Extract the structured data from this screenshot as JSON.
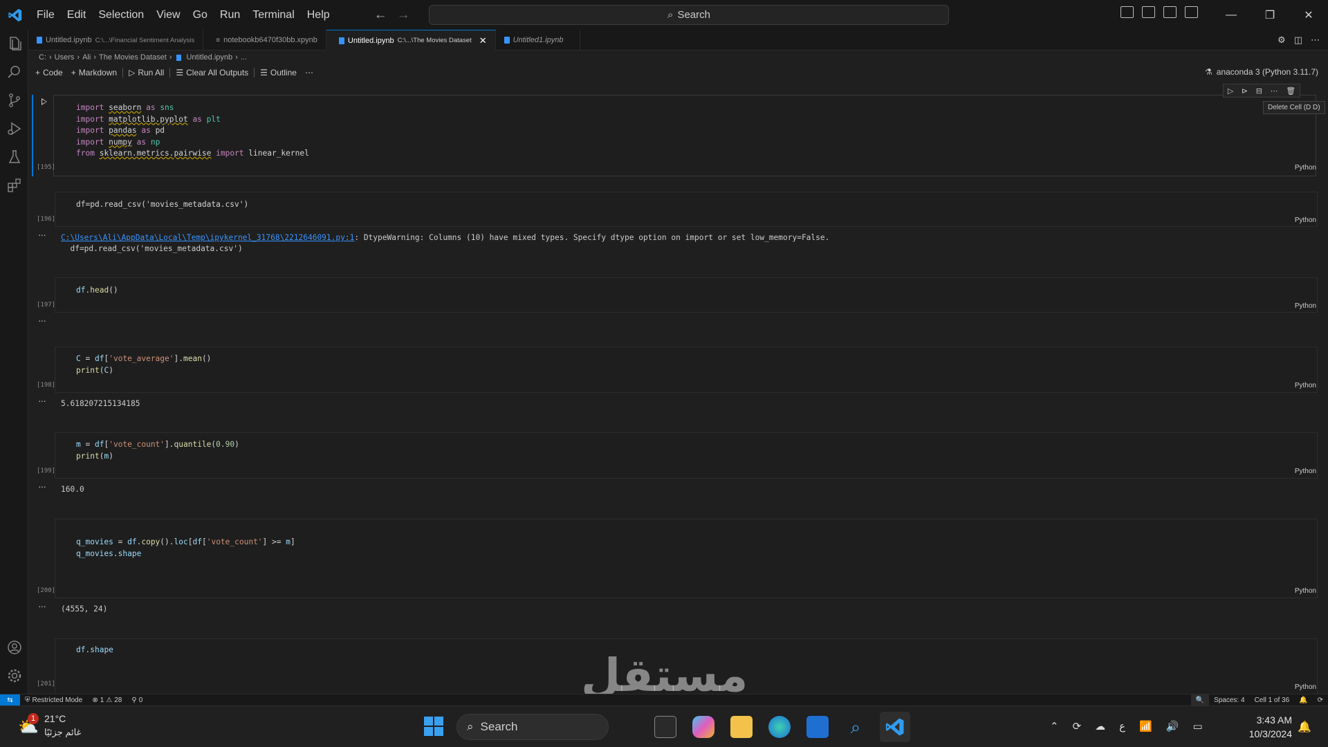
{
  "menu": [
    "File",
    "Edit",
    "Selection",
    "View",
    "Go",
    "Run",
    "Terminal",
    "Help"
  ],
  "search": {
    "label": "Search"
  },
  "tabs": [
    {
      "name": "Untitled.ipynb",
      "desc": "C:\\...\\Financial Sentiment Analysis"
    },
    {
      "name": "notebookb6470f30bb.xpynb",
      "desc": ""
    },
    {
      "name": "Untitled.ipynb",
      "desc": "C:\\...\\The Movies Dataset"
    },
    {
      "name": "Untitled1.ipynb",
      "desc": ""
    }
  ],
  "breadcrumb": {
    "c": "C:",
    "users": "Users",
    "ali": "Ali",
    "folder": "The Movies Dataset",
    "file": "Untitled.ipynb",
    "more": "..."
  },
  "toolbar": {
    "code": "Code",
    "markdown": "Markdown",
    "runall": "Run All",
    "clear": "Clear All Outputs",
    "outline": "Outline"
  },
  "kernel": "anaconda 3 (Python 3.11.7)",
  "tooltip": "Delete Cell (D D)",
  "cells": [
    {
      "exec": "[195]",
      "lang": "Python"
    },
    {
      "exec": "[196]",
      "lang": "Python",
      "code": "df=pd.read_csv('movies_metadata.csv')",
      "output_link": "C:\\Users\\Ali\\AppData\\Local\\Temp\\ipykernel_31768\\2212646091.py:1",
      "output_text": ": DtypeWarning: Columns (10) have mixed types. Specify dtype option on import or set low_memory=False.",
      "output_line2": "  df=pd.read_csv('movies_metadata.csv')"
    },
    {
      "exec": "[197]",
      "lang": "Python",
      "code": "df.head()"
    },
    {
      "exec": "[198]",
      "lang": "Python",
      "output": "5.618207215134185"
    },
    {
      "exec": "[199]",
      "lang": "Python",
      "output": "160.0"
    },
    {
      "exec": "[200]",
      "lang": "Python",
      "output": "(4555, 24)"
    },
    {
      "exec": "[201]",
      "lang": "Python",
      "code": "df.shape"
    }
  ],
  "status": {
    "mode": "Restricted Mode",
    "errors": "1",
    "warnings": "28",
    "ports": "0",
    "spaces": "Spaces: 4",
    "cell": "Cell 1 of 36"
  },
  "taskbar": {
    "temp": "21°C",
    "weather_desc": "غائم جزئيًا",
    "search": "Search",
    "badge": "1",
    "time": "3:43 AM",
    "date": "10/3/2024",
    "lang": "ع"
  },
  "watermark": "مستقل",
  "colors": {
    "accent": "#0078d4",
    "bg": "#1f1f1f"
  }
}
